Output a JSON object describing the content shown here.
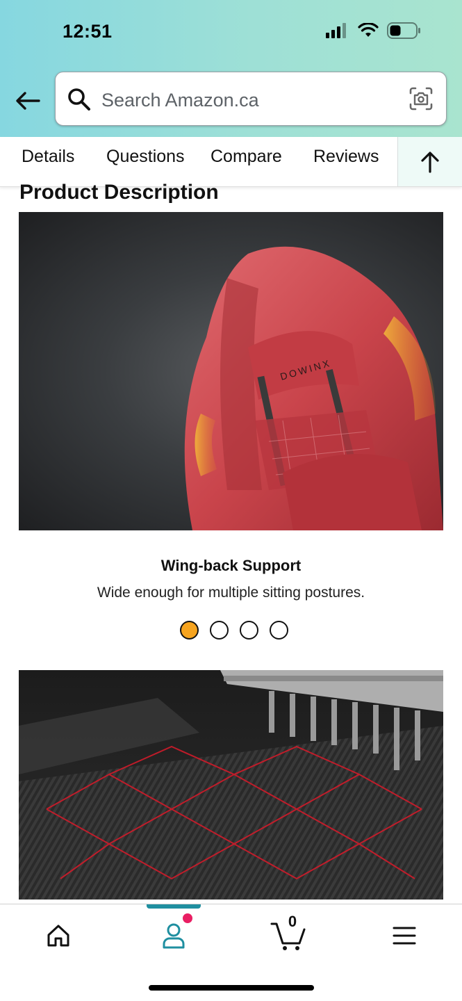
{
  "status_bar": {
    "time": "12:51"
  },
  "search": {
    "placeholder": "Search Amazon.ca"
  },
  "tabs": [
    {
      "label": "Details"
    },
    {
      "label": "Questions"
    },
    {
      "label": "Compare"
    },
    {
      "label": "Reviews"
    }
  ],
  "section_title": "Product Description",
  "carousel": {
    "caption_title": "Wing-back Support",
    "caption_subtitle": "Wide enough for multiple sitting postures.",
    "slide_count": 4,
    "active_index": 0,
    "active_color": "#f6a41f"
  },
  "bottom_nav": {
    "items": [
      {
        "icon": "home-icon"
      },
      {
        "icon": "account-icon"
      },
      {
        "icon": "cart-icon"
      },
      {
        "icon": "menu-icon"
      }
    ],
    "cart_count": "0",
    "active_item": "account-icon",
    "accent_color": "#1f8fa0",
    "notification_color": "#e91e63"
  }
}
